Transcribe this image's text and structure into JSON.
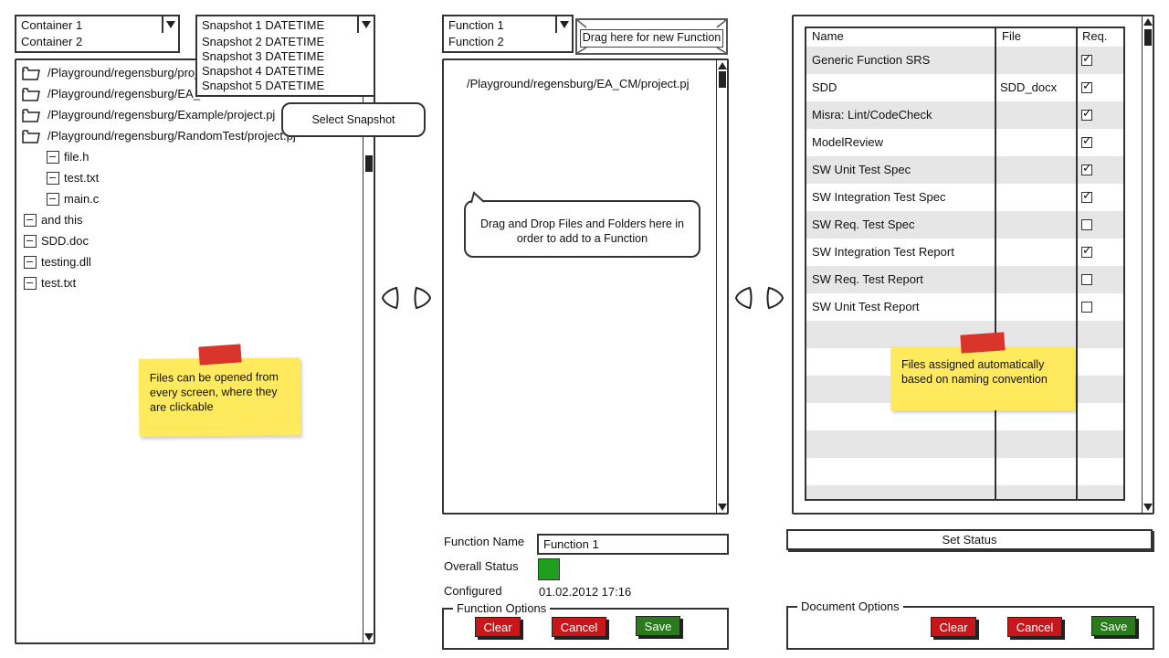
{
  "left": {
    "container_combo": "Container 1",
    "container_option": "Container 2",
    "snapshot_combo": "Snapshot 1 DATETIME",
    "snapshot_options": [
      "Snapshot 2 DATETIME",
      "Snapshot 3 DATETIME",
      "Snapshot 4 DATETIME",
      "Snapshot 5 DATETIME"
    ],
    "select_snapshot_callout": "Select Snapshot",
    "tree": [
      {
        "type": "folder",
        "label": "/Playground/regensburg/proj"
      },
      {
        "type": "folder",
        "label": "/Playground/regensburg/EA_"
      },
      {
        "type": "folder",
        "label": "/Playground/regensburg/Example/project.pj"
      },
      {
        "type": "folder",
        "label": "/Playground/regensburg/RandomTest/project.pj"
      },
      {
        "type": "file",
        "label": "file.h"
      },
      {
        "type": "file",
        "label": "test.txt"
      },
      {
        "type": "file",
        "label": "main.c"
      },
      {
        "type": "file",
        "label": "and this"
      },
      {
        "type": "file",
        "label": "SDD.doc"
      },
      {
        "type": "file",
        "label": "testing.dll"
      },
      {
        "type": "file",
        "label": "test.txt"
      }
    ],
    "note": "Files can be opened from every screen, where they are clickable",
    "tree_icons": {
      "folder": "folder-icon",
      "file": "file-icon"
    }
  },
  "middle": {
    "function_combo": "Function 1",
    "function_option": "Function 2",
    "drag_new_function": "Drag here for new Function",
    "project_path": "/Playground/regensburg/EA_CM/project.pj",
    "drag_callout": "Drag and Drop Files and Folders here in order to add to a Function",
    "function_name_label": "Function Name",
    "function_name_value": "Function 1",
    "overall_status_label": "Overall Status",
    "overall_status_color": "#1f9e1f",
    "configured_label": "Configured",
    "configured_value": "01.02.2012 17:16",
    "options_legend": "Function Options",
    "clear": "Clear",
    "cancel": "Cancel",
    "save": "Save"
  },
  "right": {
    "columns": [
      "Name",
      "File",
      "Req."
    ],
    "rows": [
      {
        "name": "Generic Function SRS",
        "file": "",
        "req": true
      },
      {
        "name": "SDD",
        "file": "SDD_docx",
        "req": true
      },
      {
        "name": "Misra: Lint/CodeCheck",
        "file": "",
        "req": true
      },
      {
        "name": "ModelReview",
        "file": "",
        "req": true
      },
      {
        "name": "SW Unit Test Spec",
        "file": "",
        "req": true
      },
      {
        "name": "SW Integration Test Spec",
        "file": "",
        "req": true
      },
      {
        "name": "SW Req. Test Spec",
        "file": "",
        "req": false
      },
      {
        "name": "SW Integration Test Report",
        "file": "",
        "req": true
      },
      {
        "name": "SW Req. Test Report",
        "file": "",
        "req": false
      },
      {
        "name": "SW Unit Test Report",
        "file": "",
        "req": false
      }
    ],
    "note": "Files assigned automatically based on naming convention",
    "set_status": "Set Status",
    "options_legend": "Document Options",
    "clear": "Clear",
    "cancel": "Cancel",
    "save": "Save"
  }
}
